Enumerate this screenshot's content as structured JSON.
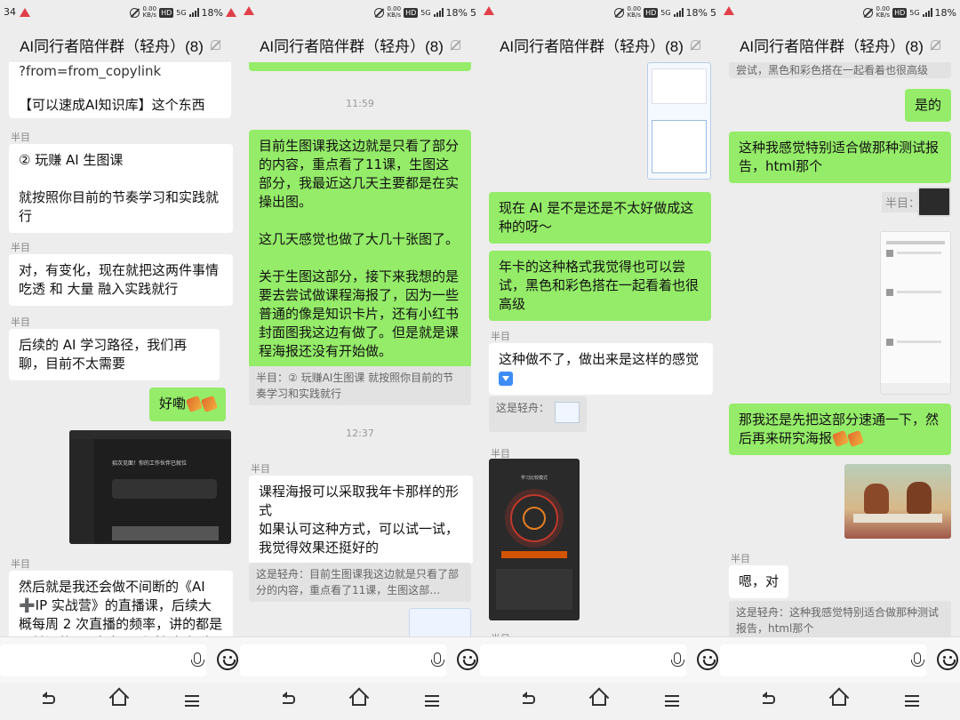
{
  "status": {
    "clock_fragment": "34",
    "net_speed": "0.00",
    "net_unit": "KB/s",
    "hd": "HD",
    "net_type": "5G",
    "battery": "18%",
    "battery_fragment": "5"
  },
  "panels": [
    {
      "title": "AI同行者陪伴群（轻舟）(8)",
      "top_text_a": "?from=from_copylink",
      "top_text_b": "【可以速成AI知识库】这个东西",
      "sender1": "半目",
      "msg1": "② 玩赚 AI 生图课\n\n就按照你目前的节奏学习和实践就行",
      "sender2": "半目",
      "msg2": "对，有变化，现在就把这两件事情 吃透 和 大量 融入实践就行",
      "sender3": "半目",
      "msg3": "后续的 AI 学习路径，我们再聊，目前不太需要",
      "msg4": "好嘞",
      "screenshot_heading": "招次见面！你的工作伙伴已就位",
      "sender5": "半目",
      "msg5": "然后就是我还会做不间断的《AI ➕IP 实战营》的直播课，后续大概每周 2 次直播的频率，讲的都是最前沿的 AI 内容，到时候根据内"
    },
    {
      "title": "AI同行者陪伴群（轻舟）(8)",
      "time1": "11:59",
      "msg1": "目前生图课我这边就是只看了部分的内容，重点看了11课，生图这部分，我最近这几天主要都是在实操出图。\n\n这几天感觉也做了大几十张图了。\n\n关于生图这部分，接下来我想的是要去尝试做课程海报了，因为一些普通的像是知识卡片，还有小红书封面图我这边有做了。但是就是课程海报还没有开始做。",
      "quote1": "半目：② 玩赚AI生图课  就按照你目前的节奏学习和实践就行",
      "time2": "12:37",
      "sender2": "半目",
      "msg2": "课程海报可以采取我年卡那样的形式\n如果认可这种方式，可以试一试，我觉得效果还挺好的",
      "quote2": "这是轻舟：目前生图课我这边就是只看了部分的内容，重点看了11课，生图这部…"
    },
    {
      "title": "AI同行者陪伴群（轻舟）(8)",
      "msg1": "现在 AI 是不是还是不太好做成这种的呀～",
      "msg2": "年卡的这种格式我觉得也可以尝试，黑色和彩色搭在一起看着也很高级",
      "sender3": "半目",
      "msg3": "这种做不了，做出来是这样的感觉",
      "quote3": "这是轻舟：",
      "sender4": "半目",
      "poster_title": "学习比较模式",
      "sender5": "半目"
    },
    {
      "title": "AI同行者陪伴群（轻舟）(8)",
      "top_text": "尝试，黑色和彩色搭在一起看着也很高级",
      "msg1": "是的",
      "msg2": "这种我感觉特别适合做那种测试报告，html那个",
      "sender3": "半目：",
      "msg4": "那我还是先把这部分速通一下，然后再来研究海报",
      "sender5": "半目",
      "msg5": "嗯，对",
      "quote5": "这是轻舟：这种我感觉特别适合做那种测试报告，html那个"
    }
  ],
  "colors": {
    "own_bubble": "#95ec69",
    "other_bubble": "#ffffff",
    "background": "#ededed",
    "alert": "#e0404a"
  },
  "icons": [
    "mute-icon",
    "bell-off-icon",
    "microphone-icon",
    "emoji-icon",
    "back-icon",
    "home-icon",
    "menu-icon"
  ]
}
